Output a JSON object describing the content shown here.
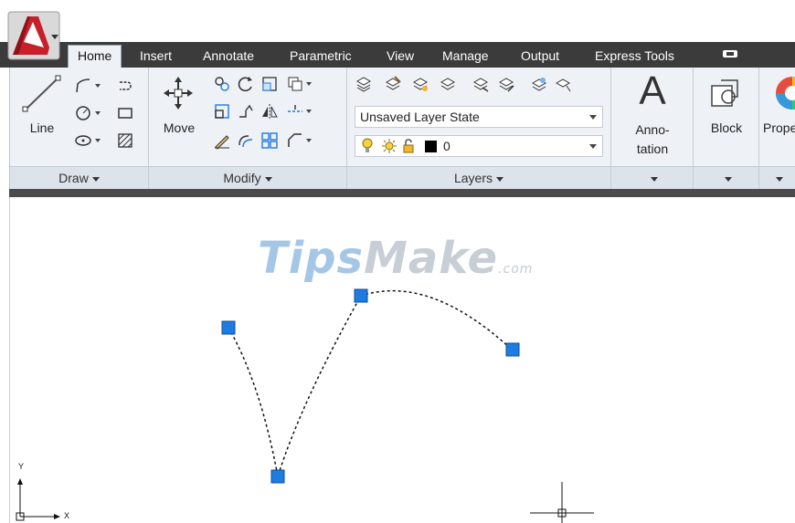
{
  "app": {
    "logo_letter": "A"
  },
  "tabs": [
    {
      "label": "Home",
      "active": true
    },
    {
      "label": "Insert"
    },
    {
      "label": "Annotate"
    },
    {
      "label": "Parametric"
    },
    {
      "label": "View"
    },
    {
      "label": "Manage"
    },
    {
      "label": "Output"
    },
    {
      "label": "Express Tools"
    }
  ],
  "panels": {
    "draw": {
      "title": "Draw",
      "line_label": "Line"
    },
    "modify": {
      "title": "Modify",
      "move_label": "Move"
    },
    "layers": {
      "title": "Layers",
      "layer_state": "Unsaved Layer State",
      "current_layer": "0"
    },
    "annotation": {
      "label_line1": "Anno-",
      "label_line2": "tation",
      "big_glyph": "A"
    },
    "block": {
      "label": "Block"
    },
    "properties": {
      "label": "Prope"
    }
  },
  "watermark": {
    "part1": "Tips",
    "part2": "Make",
    "suffix": ".com"
  },
  "ucs": {
    "y_label": "Y",
    "x_label": "X"
  },
  "colors": {
    "tab_bar": "#3b3b3b",
    "ribbon": "#eef2f6",
    "grip": "#1e7be0",
    "spline": "#111111",
    "app_red": "#c8202a"
  },
  "icons": [
    "app-menu-icon",
    "line-icon",
    "polyline-icon",
    "circle-icon",
    "arc-icon",
    "rectangle-icon",
    "hatch-icon",
    "ellipse-icon",
    "move-icon",
    "rotate-icon",
    "trim-icon",
    "copy-icon",
    "mirror-icon",
    "fillet-icon",
    "stretch-icon",
    "scale-icon",
    "array-icon",
    "erase-icon",
    "layer-properties-icon",
    "lightbulb-icon",
    "sun-icon",
    "lock-icon",
    "annotation-icon",
    "block-icon",
    "properties-icon"
  ]
}
